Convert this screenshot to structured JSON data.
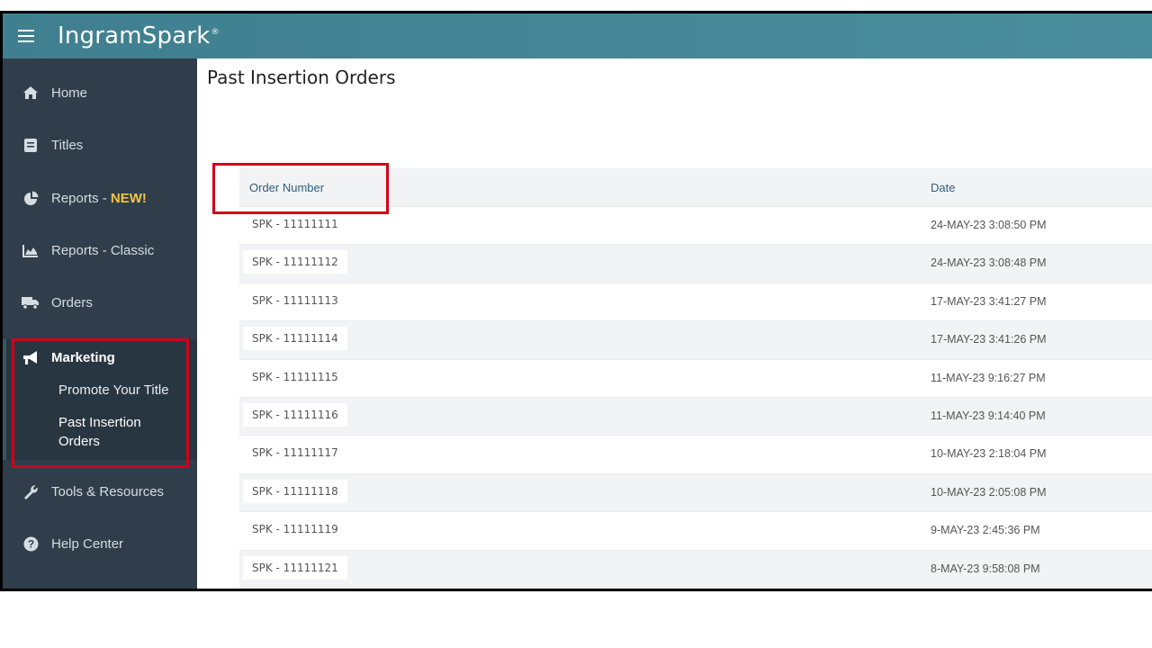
{
  "app": {
    "logo_text": "IngramSpark",
    "logo_mark": "®"
  },
  "sidebar": {
    "items": [
      {
        "label": "Home",
        "icon": "home-icon"
      },
      {
        "label": "Titles",
        "icon": "book-icon"
      },
      {
        "label": "Reports - ",
        "badge": "NEW!",
        "icon": "pie-chart-icon"
      },
      {
        "label": "Reports - Classic",
        "icon": "area-chart-icon"
      },
      {
        "label": "Orders",
        "icon": "truck-icon"
      },
      {
        "label": "Marketing",
        "icon": "megaphone-icon"
      },
      {
        "label": "Tools & Resources",
        "icon": "wrench-icon"
      },
      {
        "label": "Help Center",
        "icon": "question-icon"
      }
    ],
    "marketing_sub": [
      {
        "label": "Promote Your Title"
      },
      {
        "label": "Past Insertion Orders"
      }
    ]
  },
  "page": {
    "title": "Past Insertion Orders"
  },
  "table": {
    "headers": {
      "order": "Order Number",
      "date": "Date"
    },
    "rows": [
      {
        "order": "SPK - 11111111",
        "date": "24-MAY-23 3:08:50 PM"
      },
      {
        "order": "SPK - 11111112",
        "date": "24-MAY-23 3:08:48 PM"
      },
      {
        "order": "SPK - 11111113",
        "date": "17-MAY-23 3:41:27 PM"
      },
      {
        "order": "SPK - 11111114",
        "date": "17-MAY-23 3:41:26 PM"
      },
      {
        "order": "SPK - 11111115",
        "date": "11-MAY-23 9:16:27 PM"
      },
      {
        "order": "SPK - 11111116",
        "date": "11-MAY-23 9:14:40 PM"
      },
      {
        "order": "SPK - 11111117",
        "date": "10-MAY-23 2:18:04 PM"
      },
      {
        "order": "SPK - 11111118",
        "date": "10-MAY-23 2:05:08 PM"
      },
      {
        "order": "SPK - 11111119",
        "date": "9-MAY-23 2:45:36 PM"
      },
      {
        "order": "SPK - 11111121",
        "date": "8-MAY-23 9:58:08 PM"
      }
    ]
  },
  "colors": {
    "topbar": "#4a8d9d",
    "sidebar": "#2f3e4a",
    "highlight": "#d0021b",
    "header_text": "#2e5f7a",
    "badge": "#f5c542"
  }
}
